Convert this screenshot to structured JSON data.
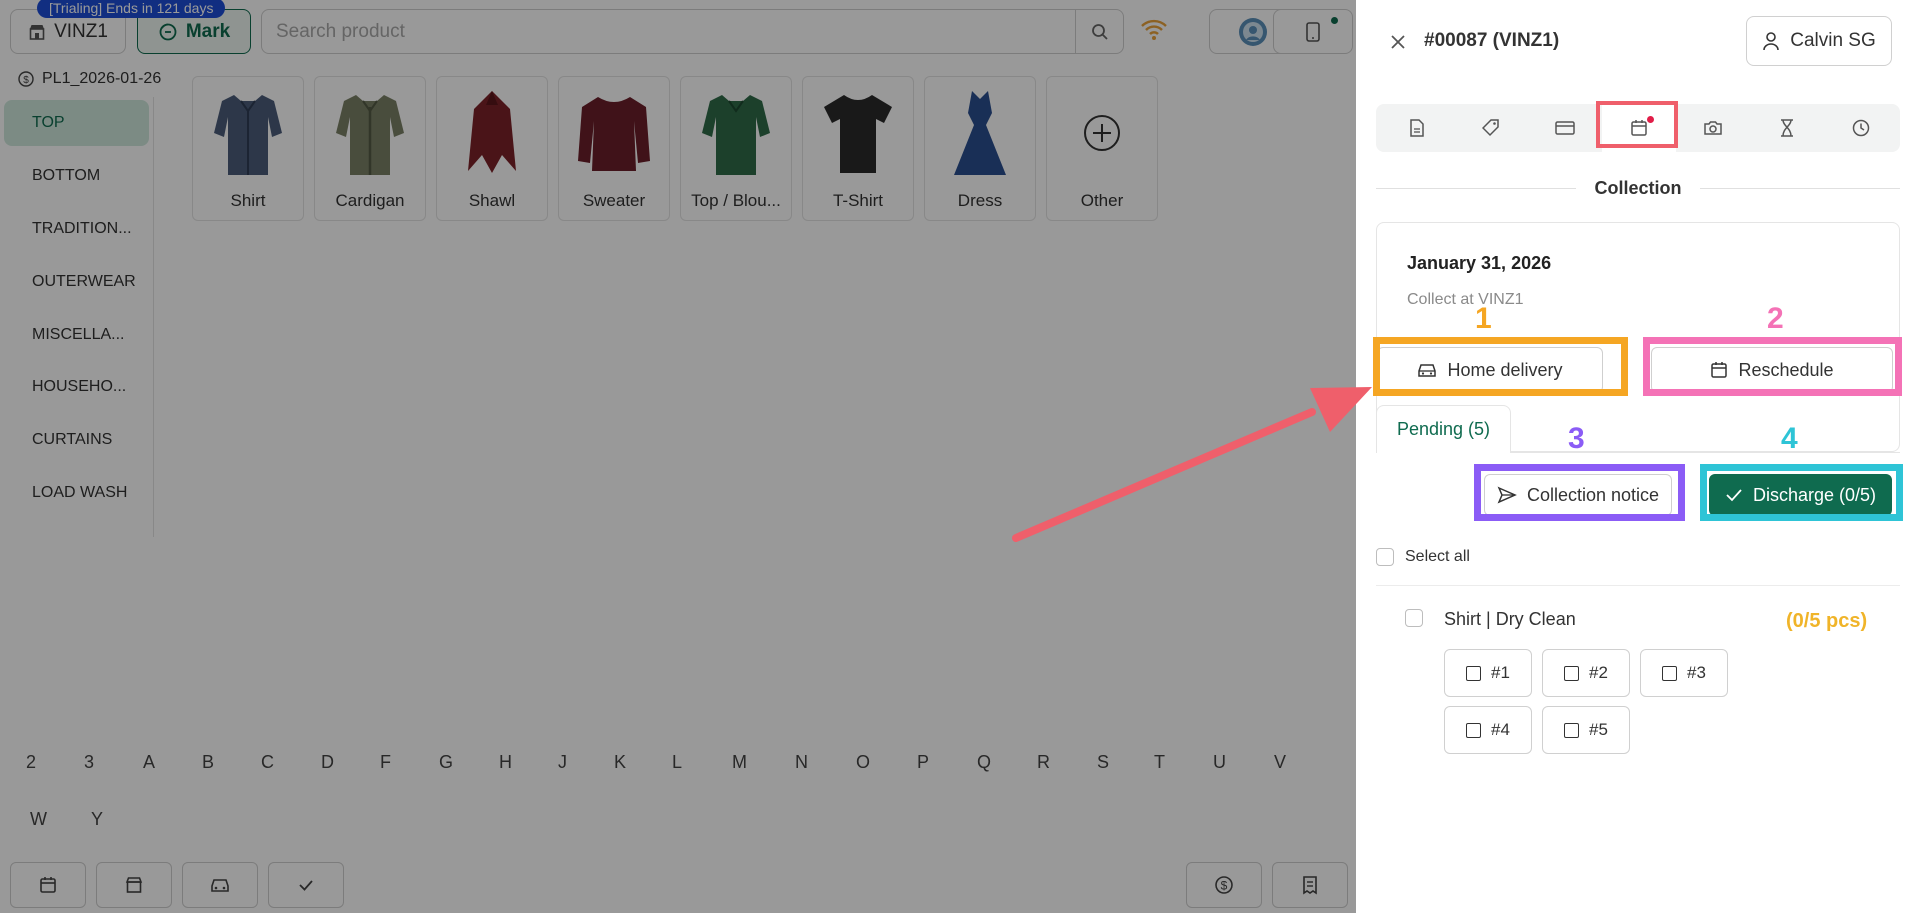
{
  "topbar": {
    "store_label": "VINZ1",
    "trial_badge": "[Trialing] Ends in 121 days",
    "mark_label": "Mark",
    "search_placeholder": "Search product"
  },
  "pricelist_label": "PL1_2026-01-26",
  "categories": [
    "TOP",
    "BOTTOM",
    "TRADITION...",
    "OUTERWEAR",
    "MISCELLA...",
    "HOUSEHO...",
    "CURTAINS",
    "LOAD WASH"
  ],
  "active_category": "TOP",
  "products": [
    {
      "label": "Shirt",
      "icon": "shirt-image"
    },
    {
      "label": "Cardigan",
      "icon": "cardigan-image"
    },
    {
      "label": "Shawl",
      "icon": "shawl-image"
    },
    {
      "label": "Sweater",
      "icon": "sweater-image"
    },
    {
      "label": "Top / Blou...",
      "icon": "blouse-image"
    },
    {
      "label": "T-Shirt",
      "icon": "tshirt-image"
    },
    {
      "label": "Dress",
      "icon": "dress-image"
    },
    {
      "label": "Other",
      "icon": "plus-circle-icon"
    }
  ],
  "alphabet": [
    "2",
    "3",
    "A",
    "B",
    "C",
    "D",
    "F",
    "G",
    "H",
    "J",
    "K",
    "L",
    "M",
    "N",
    "O",
    "P",
    "Q",
    "R",
    "S",
    "T",
    "U",
    "V",
    "W",
    "Y"
  ],
  "drawer": {
    "order_title": "#00087 (VINZ1)",
    "user_name": "Calvin SG",
    "tabs": [
      "document-icon",
      "tag-icon",
      "card-icon",
      "calendar-icon",
      "camera-icon",
      "hourglass-icon",
      "clock-icon"
    ],
    "active_tab": "calendar-icon",
    "section_title": "Collection",
    "collection_date": "January 31, 2026",
    "collect_at": "Collect at VINZ1",
    "home_delivery_label": "Home delivery",
    "reschedule_label": "Reschedule",
    "pending_tab_label": "Pending (5)",
    "collection_notice_label": "Collection notice",
    "discharge_label": "Discharge (0/5)",
    "select_all_label": "Select all",
    "item": {
      "name": "Shirt | Dry Clean",
      "count": "(0/5 pcs)",
      "pieces": [
        "#1",
        "#2",
        "#3",
        "#4",
        "#5"
      ]
    }
  },
  "annotations": {
    "numbers": [
      "1",
      "2",
      "3",
      "4"
    ],
    "colors": {
      "1": "#f5a623",
      "2": "#f472b6",
      "3": "#8b5cf6",
      "4": "#2ec4d6",
      "tab": "#ef5f6b",
      "arrow": "#ef5f6b"
    }
  }
}
